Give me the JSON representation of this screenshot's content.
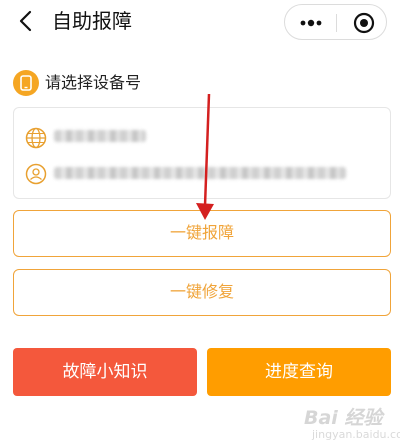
{
  "nav": {
    "title": "自助报障"
  },
  "device": {
    "section_label": "请选择设备号"
  },
  "actions": {
    "onekey_report": "一键报障",
    "onekey_repair": "一键修复",
    "knowledge": "故障小知识",
    "progress": "进度查询"
  },
  "colors": {
    "accent_orange": "#f0a43a",
    "knowledge_red": "#f4583c",
    "progress_orange": "#ff9d00",
    "annotation_arrow": "#d42020"
  },
  "icons": [
    "back-icon",
    "more-icon",
    "target-icon",
    "device-icon",
    "globe-icon",
    "user-icon"
  ],
  "watermark": {
    "text": "Bai 经验",
    "sub": "jingyan.baidu.com"
  }
}
